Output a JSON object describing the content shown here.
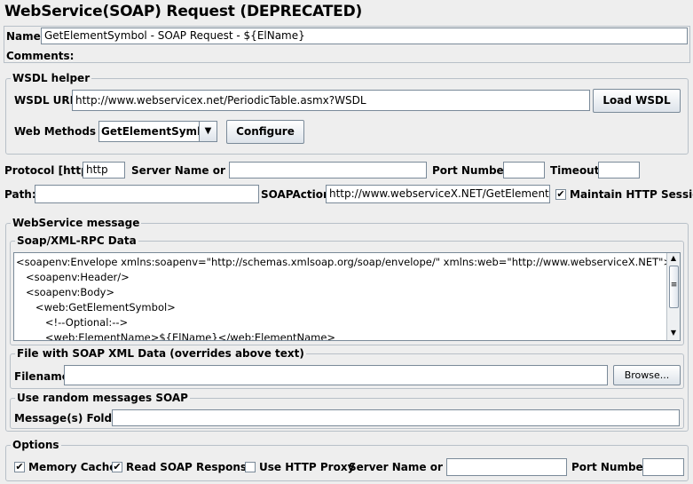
{
  "title": "WebService(SOAP) Request (DEPRECATED)",
  "name": {
    "label": "Name:",
    "value": "GetElementSymbol - SOAP Request - ${ElName}"
  },
  "comments": {
    "label": "Comments:",
    "value": ""
  },
  "wsdl": {
    "legend": "WSDL helper",
    "url_label": "WSDL URL",
    "url_value": "http://www.webservicex.net/PeriodicTable.asmx?WSDL",
    "load_button": "Load WSDL",
    "methods_label": "Web Methods",
    "method_selected": "GetElementSymbol",
    "configure_button": "Configure"
  },
  "server": {
    "protocol_label": "Protocol [http]:",
    "protocol_value": "http",
    "server_label": "Server Name or IP:",
    "server_value": "",
    "port_label": "Port Number:",
    "port_value": "",
    "timeout_label": "Timeout:",
    "timeout_value": "",
    "path_label": "Path:",
    "path_value": "",
    "soapaction_label": "SOAPAction",
    "soapaction_value": "http://www.webserviceX.NET/GetElementSymbol",
    "maintain_session_label": "Maintain HTTP Session",
    "maintain_session_checked": true
  },
  "message": {
    "legend": "WebService message",
    "soap_legend": "Soap/XML-RPC Data",
    "lines": [
      "<soapenv:Envelope xmlns:soapenv=\"http://schemas.xmlsoap.org/soap/envelope/\" xmlns:web=\"http://www.webserviceX.NET\">",
      "   <soapenv:Header/>",
      "   <soapenv:Body>",
      "      <web:GetElementSymbol>",
      "         <!--Optional:-->",
      "         <web:ElementName>${ElName}</web:ElementName>"
    ],
    "file_legend": "File with SOAP XML Data (overrides above text)",
    "filename_label": "Filename",
    "filename_value": "",
    "browse_button": "Browse...",
    "random_legend": "Use random messages SOAP",
    "folder_label": "Message(s) Folder",
    "folder_value": ""
  },
  "options": {
    "legend": "Options",
    "memory_cache_label": "Memory Cache",
    "memory_cache_checked": true,
    "read_response_label": "Read SOAP Response",
    "read_response_checked": true,
    "http_proxy_label": "Use HTTP Proxy",
    "http_proxy_checked": false,
    "proxy_server_label": "Server Name or IP:",
    "proxy_server_value": "",
    "proxy_port_label": "Port Number:",
    "proxy_port_value": ""
  },
  "glyphs": {
    "check": "✔",
    "down": "▼",
    "up": "▲",
    "grip": "≡"
  }
}
